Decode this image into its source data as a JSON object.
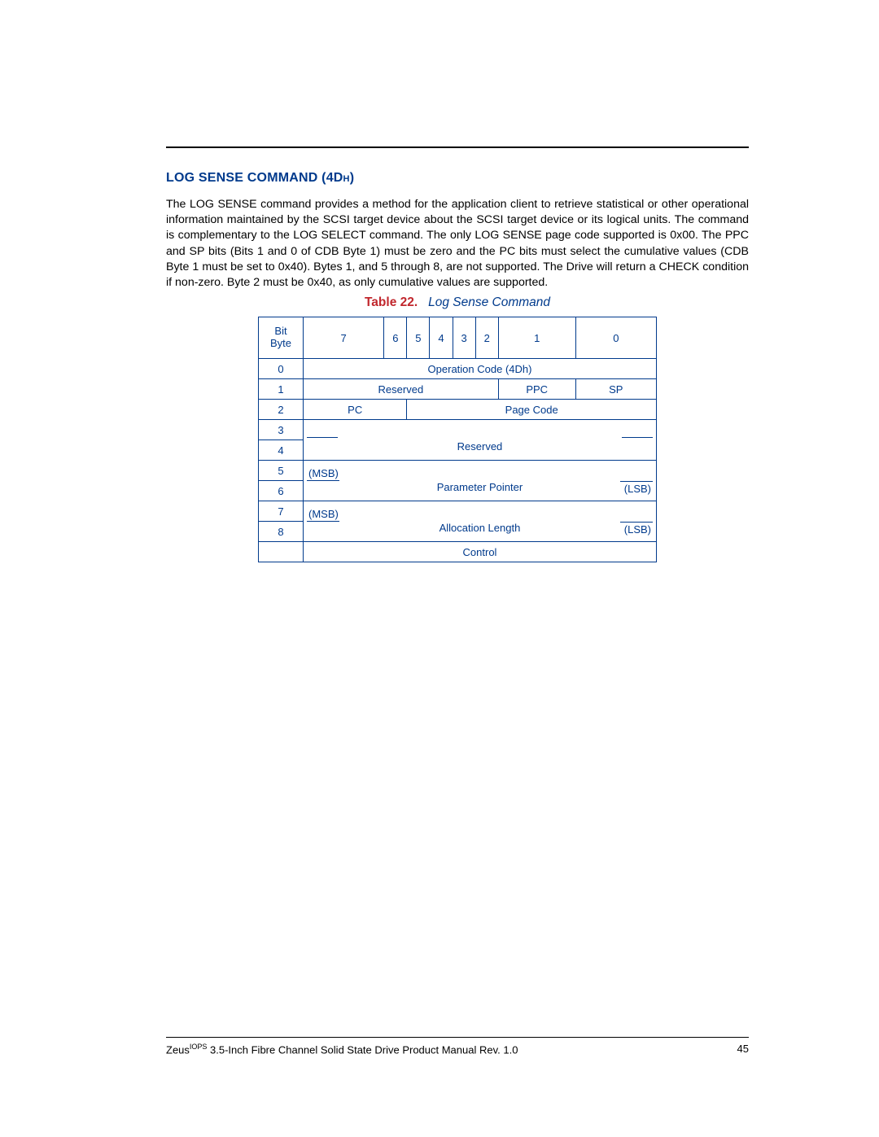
{
  "heading": "LOG SENSE COMMAND (4Dh)",
  "paragraph": "The LOG SENSE command provides a method for the application client to retrieve statistical or other operational information maintained by the SCSI target device about the SCSI target device or its logical units. The command is complementary to the LOG SELECT command. The only LOG SENSE page code supported is 0x00. The PPC and SP bits (Bits 1 and 0 of CDB Byte 1) must be zero and the PC bits must select the cumulative values (CDB Byte 1 must be set to 0x40). Bytes 1, and 5 through 8, are not supported. The Drive will return a CHECK condition if non-zero. Byte 2 must be 0x40, as only cumulative values are supported.",
  "table": {
    "label": "Table 22.",
    "title": "Log Sense Command",
    "header": {
      "bit": "Bit",
      "byte": "Byte"
    },
    "bits": [
      "7",
      "6",
      "5",
      "4",
      "3",
      "2",
      "1",
      "0"
    ],
    "byteLabels": [
      "0",
      "1",
      "2",
      "3",
      "4",
      "5",
      "6",
      "7",
      "8",
      ""
    ],
    "fields": {
      "opcode": "Operation Code (4Dh)",
      "reserved1": "Reserved",
      "ppc": "PPC",
      "sp": "SP",
      "pc": "PC",
      "pageCode": "Page Code",
      "reserved2": "Reserved",
      "paramPointer": "Parameter Pointer",
      "allocLength": "Allocation Length",
      "msb": "(MSB)",
      "lsb": "(LSB)",
      "control": "Control"
    }
  },
  "footer": {
    "product": "Zeus",
    "sup": "IOPS",
    "rest": " 3.5-Inch Fibre Channel Solid State Drive Product Manual Rev. 1.0",
    "page": "45"
  }
}
